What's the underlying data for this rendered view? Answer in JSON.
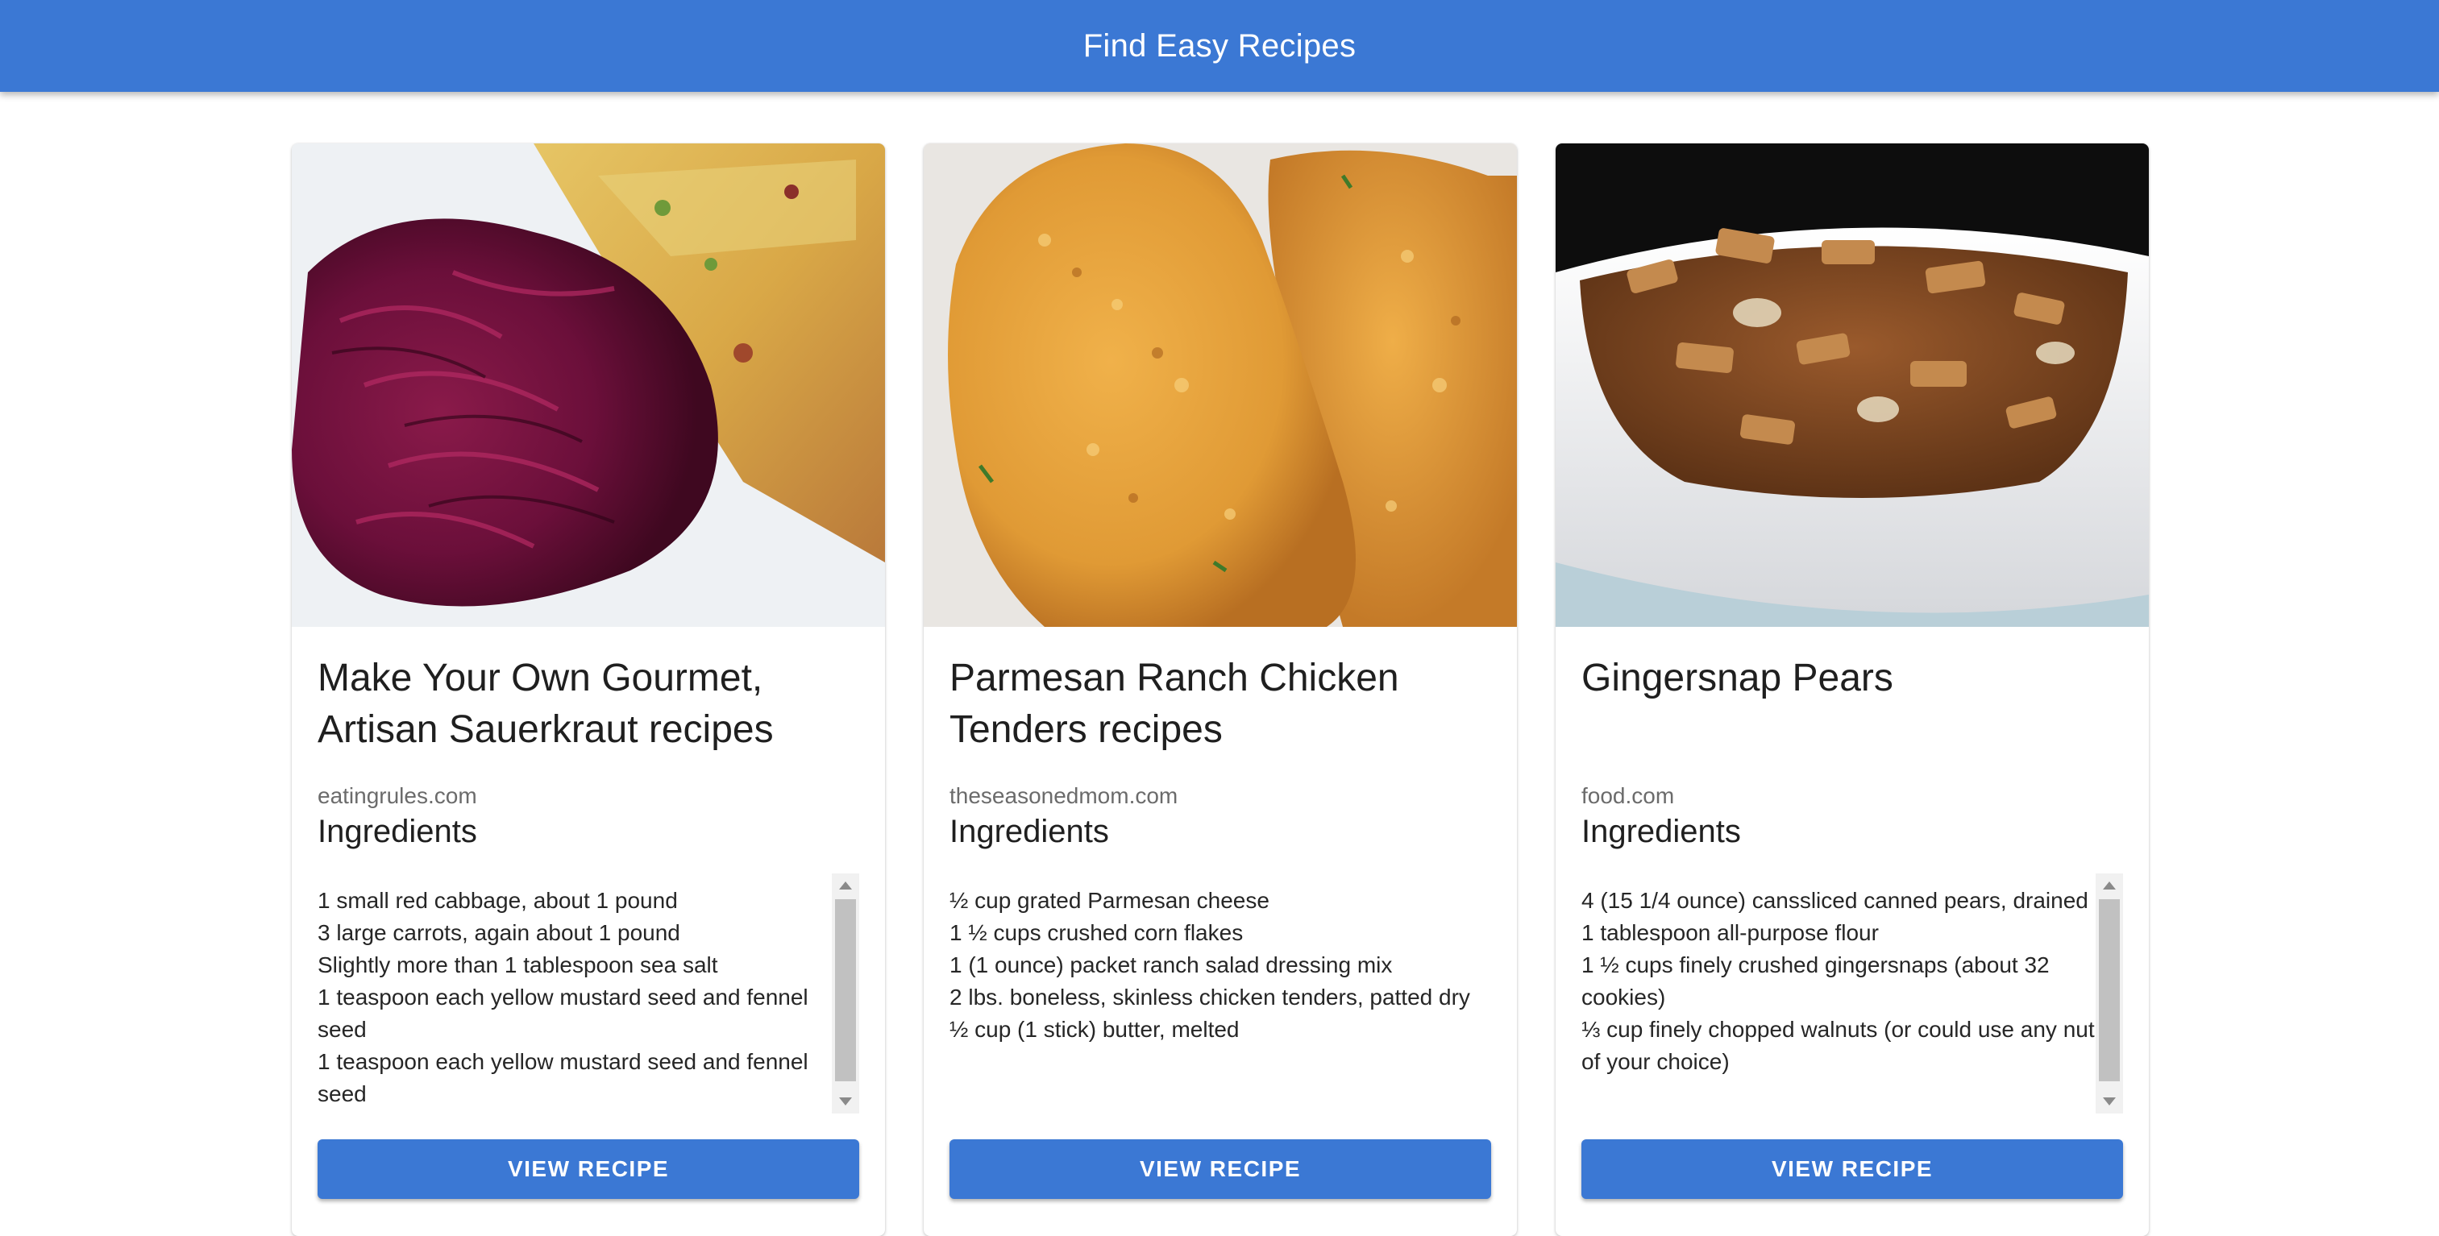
{
  "appbar": {
    "title": "Find Easy Recipes"
  },
  "theme": {
    "primary": "#3b78d4",
    "text": "#212121",
    "muted": "#6b6b6b"
  },
  "recipes": [
    {
      "title": "Make Your Own Gourmet, Artisan Sauerkraut recipes",
      "source": "eatingrules.com",
      "ingredients_heading": "Ingredients",
      "ingredients": [
        "1 small red cabbage, about 1 pound",
        "3 large carrots, again about 1 pound",
        "Slightly more than 1 tablespoon sea salt",
        "1 teaspoon each yellow mustard seed and fennel seed",
        "1 teaspoon each yellow mustard seed and fennel seed"
      ],
      "button_label": "VIEW RECIPE"
    },
    {
      "title": "Parmesan Ranch Chicken Tenders recipes",
      "source": "theseasonedmom.com",
      "ingredients_heading": "Ingredients",
      "ingredients": [
        "½ cup grated Parmesan cheese",
        "1 ½ cups crushed corn flakes",
        "1 (1 ounce) packet ranch salad dressing mix",
        "2 lbs. boneless, skinless chicken tenders, patted dry",
        "½ cup (1 stick) butter, melted"
      ],
      "button_label": "VIEW RECIPE"
    },
    {
      "title": "Gingersnap Pears",
      "source": "food.com",
      "ingredients_heading": "Ingredients",
      "ingredients": [
        "4 (15 1/4 ounce) canssliced canned pears, drained",
        "1 tablespoon all-purpose flour",
        "1 ½ cups finely crushed gingersnaps (about 32 cookies)",
        "⅓ cup finely chopped walnuts (or could use any nut of your choice)"
      ],
      "button_label": "VIEW RECIPE"
    }
  ]
}
